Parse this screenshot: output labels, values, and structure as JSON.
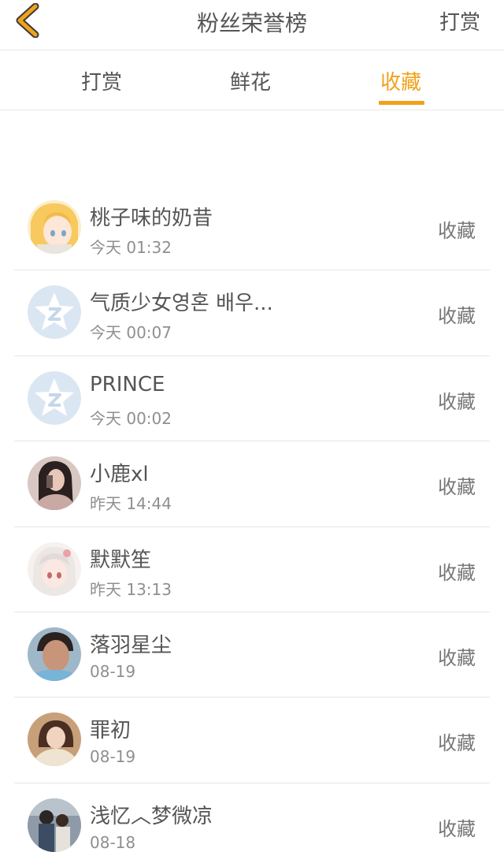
{
  "header": {
    "title": "粉丝荣誉榜",
    "right_action": "打赏",
    "back_icon": "chevron-left-icon",
    "back_color": "#f0a21a"
  },
  "tabs": [
    {
      "label": "打赏",
      "active": false
    },
    {
      "label": "鲜花",
      "active": false
    },
    {
      "label": "收藏",
      "active": true
    }
  ],
  "accent_color": "#f0a21a",
  "list": [
    {
      "name": "桃子味的奶昔",
      "time": "今天 01:32",
      "action": "收藏",
      "avatar": "anime-girl-blonde"
    },
    {
      "name": "气质少女영혼 배우...",
      "time": "今天 00:07",
      "action": "收藏",
      "avatar": "default-star"
    },
    {
      "name": "PRINCE",
      "time": "今天 00:02",
      "action": "收藏",
      "avatar": "default-star"
    },
    {
      "name": "小鹿xl",
      "time": "昨天 14:44",
      "action": "收藏",
      "avatar": "photo-girl-dark-hair"
    },
    {
      "name": "默默笙",
      "time": "昨天 13:13",
      "action": "收藏",
      "avatar": "anime-girl-white-hair"
    },
    {
      "name": "落羽星尘",
      "time": "08-19",
      "action": "收藏",
      "avatar": "photo-boy"
    },
    {
      "name": "罪初",
      "time": "08-19",
      "action": "收藏",
      "avatar": "photo-girl-warm"
    },
    {
      "name": "浅忆︿梦微凉",
      "time": "08-18",
      "action": "收藏",
      "avatar": "photo-couple"
    }
  ]
}
